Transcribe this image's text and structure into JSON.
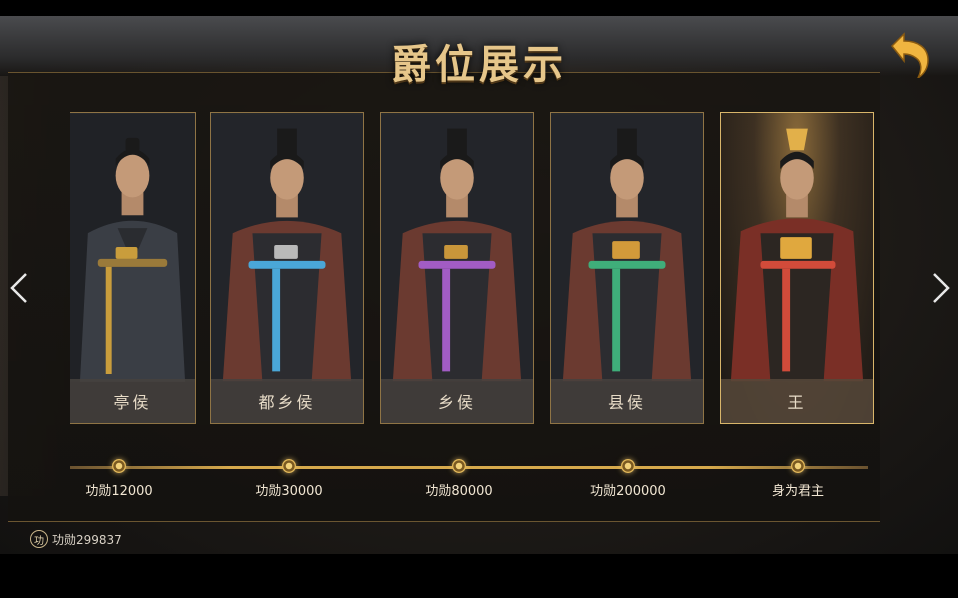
{
  "title": "爵位展示",
  "ranks": [
    {
      "name": "亭侯",
      "requirement": "功勋12000",
      "sash_color": "#c99d3c"
    },
    {
      "name": "都乡侯",
      "requirement": "功勋30000",
      "sash_color": "#4aa7d8"
    },
    {
      "name": "乡侯",
      "requirement": "功勋80000",
      "sash_color": "#a25cc4"
    },
    {
      "name": "县侯",
      "requirement": "功勋200000",
      "sash_color": "#3fae7a"
    },
    {
      "name": "王",
      "requirement": "身为君主",
      "sash_color": "#d24b3a"
    }
  ],
  "merit": {
    "icon_glyph": "功",
    "label": "功勋299837"
  },
  "icons": {
    "back": "back-arrow-icon",
    "prev": "chevron-left-icon",
    "next": "chevron-right-icon"
  },
  "colors": {
    "gold": "#d6a94c",
    "title": "#e6c68a"
  }
}
